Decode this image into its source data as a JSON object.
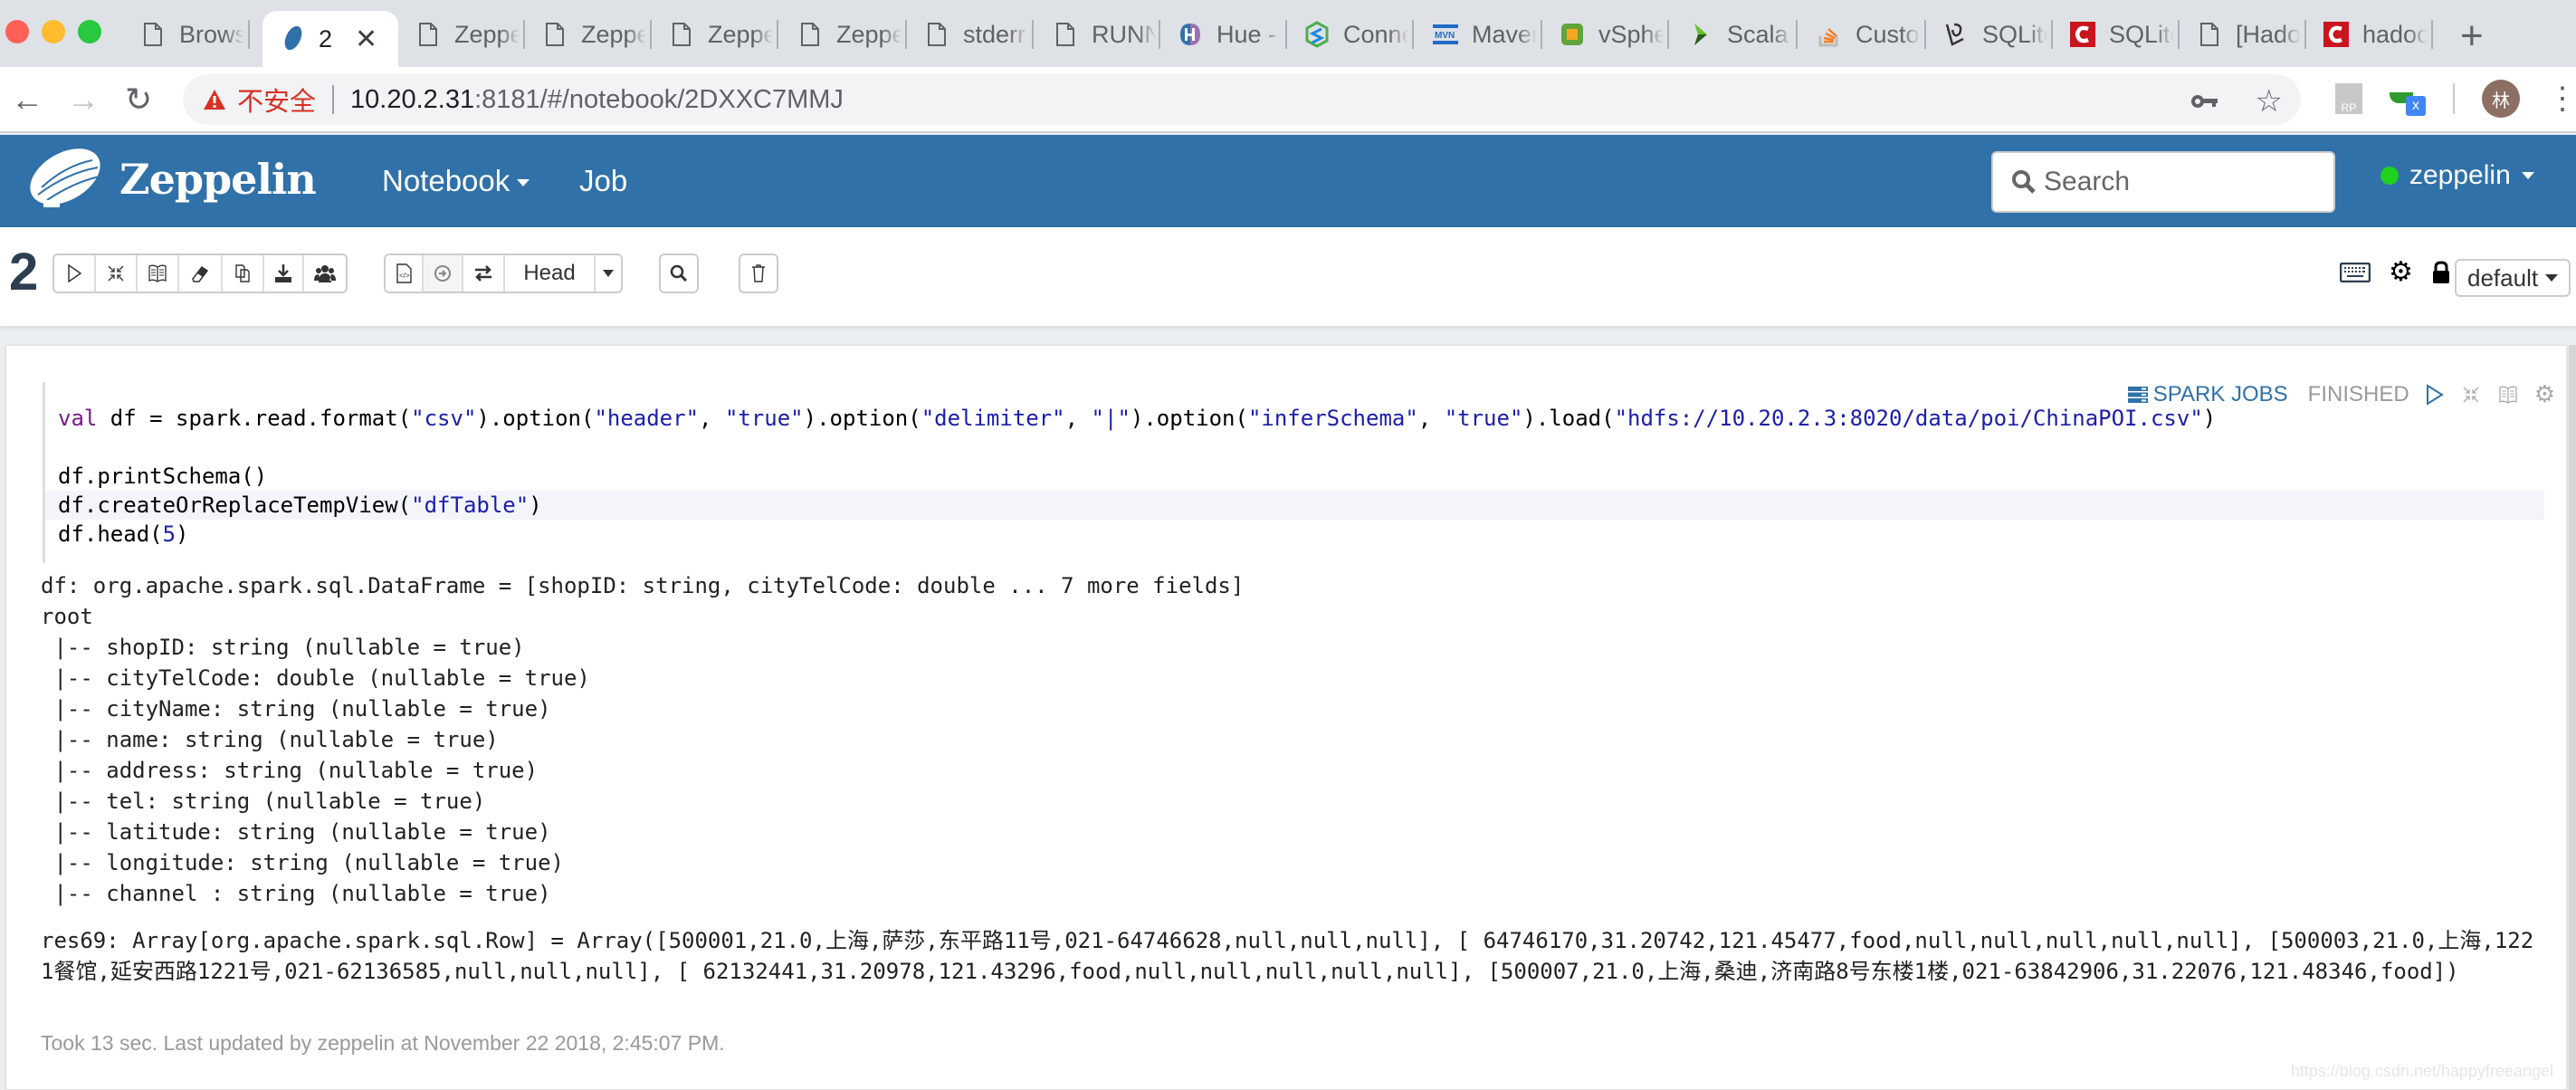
{
  "browser": {
    "tabs": [
      {
        "label": "Browse",
        "icon": "page-icon",
        "active": false
      },
      {
        "label": "2",
        "icon": "zeppelin-icon",
        "active": true
      },
      {
        "label": "Zeppelin",
        "icon": "page-icon",
        "active": false
      },
      {
        "label": "Zeppelin",
        "icon": "page-icon",
        "active": false
      },
      {
        "label": "Zeppelin",
        "icon": "page-icon",
        "active": false
      },
      {
        "label": "Zeppelin",
        "icon": "page-icon",
        "active": false
      },
      {
        "label": "stderr",
        "icon": "page-icon",
        "active": false
      },
      {
        "label": "RUNNING",
        "icon": "page-icon",
        "active": false
      },
      {
        "label": "Hue -",
        "icon": "hue-icon",
        "active": false
      },
      {
        "label": "Connect",
        "icon": "connect-icon",
        "active": false
      },
      {
        "label": "Maven",
        "icon": "maven-icon",
        "active": false
      },
      {
        "label": "vSphere",
        "icon": "vsphere-icon",
        "active": false
      },
      {
        "label": "Scala",
        "icon": "scala-icon",
        "active": false
      },
      {
        "label": "Custom",
        "icon": "stackoverflow-icon",
        "active": false
      },
      {
        "label": "SQLite",
        "icon": "sqlite-icon",
        "active": false
      },
      {
        "label": "SQLite",
        "icon": "csdn-icon",
        "active": false
      },
      {
        "label": "[Hadoop",
        "icon": "page-icon",
        "active": false
      },
      {
        "label": "hadoop",
        "icon": "csdn-icon",
        "active": false
      }
    ],
    "close_glyph": "✕",
    "new_tab_glyph": "+",
    "address": {
      "security_label": "不安全",
      "host": "10.20.2.31",
      "rest": ":8181/#/notebook/2DXXC7MMJ"
    },
    "avatar_initial": "林",
    "extensions": [
      "RP",
      "x"
    ]
  },
  "header": {
    "brand": "Zeppelin",
    "nav": [
      {
        "label": "Notebook",
        "has_caret": true
      },
      {
        "label": "Job",
        "has_caret": false
      }
    ],
    "search_placeholder": "Search",
    "user": "zeppelin",
    "status_color": "#1ed21e",
    "brand_color": "#3071a9"
  },
  "notebook": {
    "title": "2",
    "toolbar_group1": [
      "run-all",
      "show-hide-code",
      "show-hide-output",
      "clear-output",
      "clone-note",
      "export-note",
      "collaboration"
    ],
    "toolbar_group2": [
      "version-control",
      "commit",
      "revision-compare"
    ],
    "revision_label": "Head",
    "interpreter_binding": "default"
  },
  "paragraph": {
    "spark_jobs_label": "SPARK JOBS",
    "status": "FINISHED",
    "code": {
      "line1": {
        "kw": "val",
        "p1": " df = spark.read.format(",
        "s1": "\"csv\"",
        "p2": ").option(",
        "s2": "\"header\"",
        "p3": ", ",
        "s3": "\"true\"",
        "p4": ").option(",
        "s4": "\"delimiter\"",
        "p5": ", ",
        "s5": "\"|\"",
        "p6": ").option(",
        "s6": "\"inferSchema\"",
        "p7": ", ",
        "s7": "\"true\"",
        "p8": ").load(",
        "s8": "\"hdfs://10.20.2.3:8020/data/poi/ChinaPOI.csv\"",
        "p9": ")"
      },
      "line3": "df.printSchema()",
      "line4_pre": "df.createOrReplaceTempView(",
      "line4_str": "\"dfTable\"",
      "line4_post": ")",
      "line5_pre": "df.head(",
      "line5_num": "5",
      "line5_post": ")"
    },
    "output": {
      "df_line": "df: org.apache.spark.sql.DataFrame = [shopID: string, cityTelCode: double ... 7 more fields]",
      "root": "root",
      "schema": [
        " |-- shopID: string (nullable = true)",
        " |-- cityTelCode: double (nullable = true)",
        " |-- cityName: string (nullable = true)",
        " |-- name: string (nullable = true)",
        " |-- address: string (nullable = true)",
        " |-- tel: string (nullable = true)",
        " |-- latitude: string (nullable = true)",
        " |-- longitude: string (nullable = true)",
        " |-- channel : string (nullable = true)"
      ],
      "result": "res69: Array[org.apache.spark.sql.Row] = Array([500001,21.0,上海,萨莎,东平路11号,021-64746628,null,null,null], [ 64746170,31.20742,121.45477,food,null,null,null,null,null], [500003,21.0,上海,1221餐馆,延安西路1221号,021-62136585,null,null,null], [ 62132441,31.20978,121.43296,food,null,null,null,null,null], [500007,21.0,上海,桑迪,济南路8号东楼1楼,021-63842906,31.22076,121.48346,food])"
    },
    "footer": "Took 13 sec. Last updated by zeppelin at November 22 2018, 2:45:07 PM."
  },
  "watermark": "https://blog.csdn.net/happyfreeangel"
}
